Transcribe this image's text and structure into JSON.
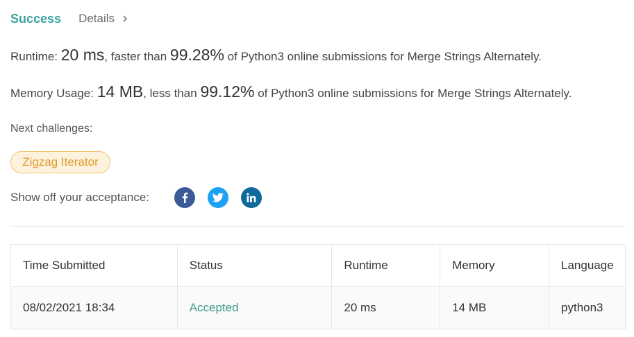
{
  "header": {
    "status": "Success",
    "details_label": "Details"
  },
  "runtime": {
    "label": "Runtime:",
    "value": "20 ms",
    "comparison": ", faster than",
    "percent": "99.28%",
    "suffix": "of Python3 online submissions for Merge Strings Alternately."
  },
  "memory": {
    "label": "Memory Usage:",
    "value": "14 MB",
    "comparison": ", less than",
    "percent": "99.12%",
    "suffix": "of Python3 online submissions for Merge Strings Alternately."
  },
  "next_challenges": {
    "label": "Next challenges:",
    "items": [
      "Zigzag Iterator"
    ]
  },
  "share": {
    "label": "Show off your acceptance:",
    "icons": [
      "facebook-icon",
      "twitter-icon",
      "linkedin-icon"
    ]
  },
  "table": {
    "headers": [
      "Time Submitted",
      "Status",
      "Runtime",
      "Memory",
      "Language"
    ],
    "rows": [
      [
        "08/02/2021 18:34",
        "Accepted",
        "20 ms",
        "14 MB",
        "python3"
      ]
    ]
  },
  "colors": {
    "success": "#3aa3a0",
    "accepted": "#3f9c84",
    "tag_border": "#f3c36b",
    "tag_text": "#e09a2c",
    "facebook": "#3b5a98",
    "twitter": "#1da1f2",
    "linkedin": "#0e6a9c"
  }
}
